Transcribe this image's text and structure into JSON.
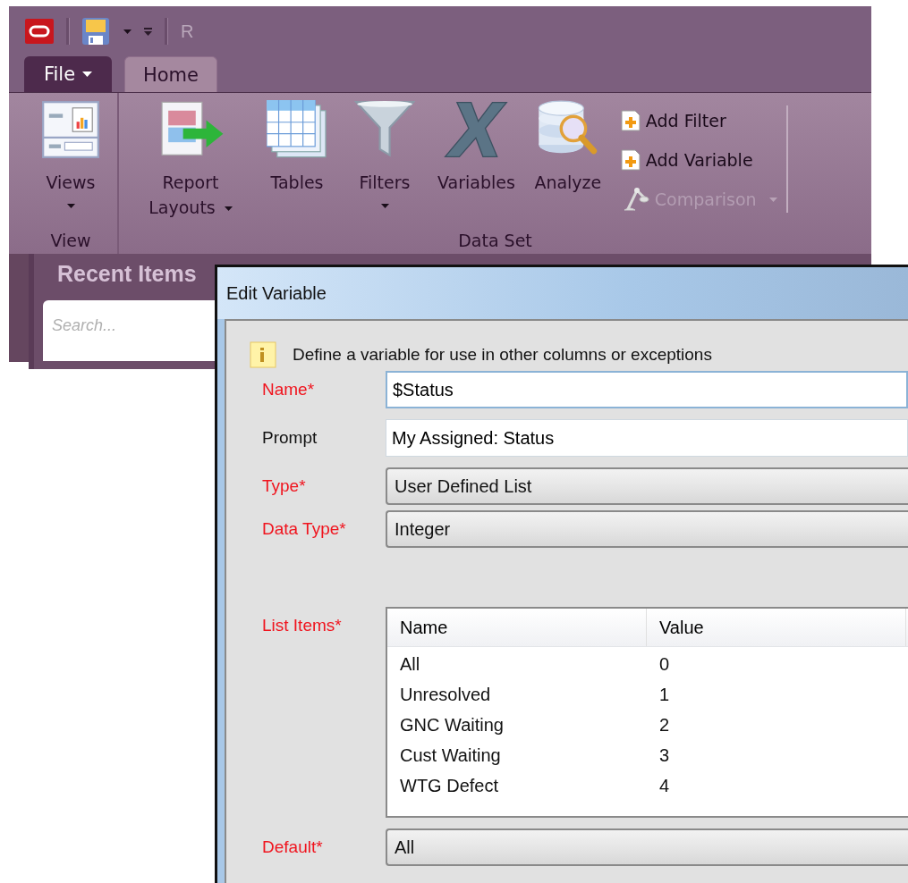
{
  "quick_access": {
    "title": "R"
  },
  "tabs": [
    {
      "label": "File",
      "kind": "menu",
      "selected": false
    },
    {
      "label": "Home",
      "kind": "tab",
      "selected": true
    }
  ],
  "ribbon_groups": [
    {
      "label": "View",
      "buttons": [
        {
          "label": "Views",
          "dropdown": true
        }
      ]
    },
    {
      "label": "Data Set",
      "buttons": [
        {
          "label": "Report Layouts",
          "dropdown": true
        },
        {
          "label": "Tables",
          "dropdown": false
        },
        {
          "label": "Filters",
          "dropdown": true
        },
        {
          "label": "Variables",
          "dropdown": false
        },
        {
          "label": "Analyze",
          "dropdown": false
        }
      ],
      "small_buttons": [
        {
          "label": "Add Filter",
          "disabled": false,
          "dropdown": false
        },
        {
          "label": "Add Variable",
          "disabled": false,
          "dropdown": false
        },
        {
          "label": "Comparison",
          "disabled": true,
          "dropdown": true
        }
      ]
    }
  ],
  "sidebar": {
    "title": "Recent Items",
    "search": {
      "placeholder": "Search..."
    }
  },
  "dialog": {
    "title": "Edit Variable",
    "info": "Define a variable for use in other columns or exceptions",
    "fields": [
      {
        "label": "Name*",
        "required": true,
        "kind": "text",
        "focused": true,
        "value": "$Status"
      },
      {
        "label": "Prompt",
        "required": false,
        "kind": "text",
        "focused": false,
        "value": "My Assigned: Status"
      },
      {
        "label": "Type*",
        "required": true,
        "kind": "combo",
        "value": "User Defined List"
      },
      {
        "label": "Data Type*",
        "required": true,
        "kind": "combo",
        "value": "Integer"
      },
      {
        "label": "List Items*",
        "required": true,
        "kind": "list",
        "columns": [
          "Name",
          "Value"
        ],
        "rows": [
          [
            "All",
            "0"
          ],
          [
            "Unresolved",
            "1"
          ],
          [
            "GNC Waiting",
            "2"
          ],
          [
            "Cust Waiting",
            "3"
          ],
          [
            "WTG Defect",
            "4"
          ]
        ]
      },
      {
        "label": "Default*",
        "required": true,
        "kind": "combo",
        "value": "All"
      }
    ]
  }
}
